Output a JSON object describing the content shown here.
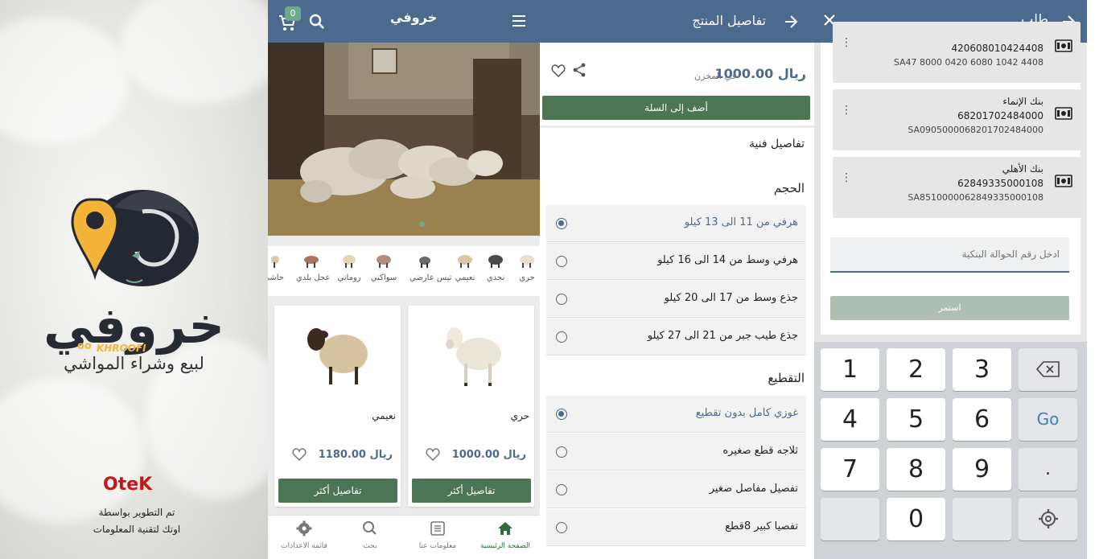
{
  "splash": {
    "brand_ar": "خروفي",
    "brand_latin": "KHROOFI",
    "tagline": "لبيع وشراء المواشي",
    "dev_logo": "OteK",
    "dev_line1": "تم التطوير بواسطة",
    "dev_line2": "اوتك لتقنية المعلومات"
  },
  "home": {
    "cart_count": "0",
    "logo_text": "خروفي",
    "categories": [
      {
        "label": "حري"
      },
      {
        "label": "نجدي"
      },
      {
        "label": "نعيمي"
      },
      {
        "label": "تيس عارضي"
      },
      {
        "label": "سواكني"
      },
      {
        "label": "روماني"
      },
      {
        "label": "عجل بلدي"
      },
      {
        "label": "حاشي"
      }
    ],
    "products": [
      {
        "name": "حري",
        "price": "ريال 1000.00",
        "button": "تفاصيل أكثر"
      },
      {
        "name": "نعيمي",
        "price": "ريال 1180.00",
        "button": "تفاصيل أكثر"
      }
    ],
    "nav": [
      {
        "label": "الصفحة الرئيسية",
        "icon": "home-icon"
      },
      {
        "label": "معلومات عنا",
        "icon": "info-icon"
      },
      {
        "label": "بحث",
        "icon": "search-icon"
      },
      {
        "label": "قائمة الاعدادات",
        "icon": "gear-icon"
      }
    ]
  },
  "product": {
    "title": "تفاصيل المنتج",
    "price": "ريال 1000.00",
    "stock": "في المخزن",
    "add_to_cart": "أضف إلى السلة",
    "tech_details": "تفاصيل فنية",
    "size_title": "الحجم",
    "sizes": [
      {
        "label": "هرفي من 11 الى 13 كيلو",
        "selected": true
      },
      {
        "label": "هرفي وسط من 14 الى 16 كيلو",
        "selected": false
      },
      {
        "label": "جذع وسط من 17 الى 20 كيلو",
        "selected": false
      },
      {
        "label": "جذع طيب جبر من 21 الى 27 كيلو",
        "selected": false
      }
    ],
    "cut_title": "التقطيع",
    "cuts": [
      {
        "label": "غوزي كامل بدون تقطيع",
        "selected": true
      },
      {
        "label": "ثلاجه قطع صغيره",
        "selected": false
      },
      {
        "label": "تفصيل مفاصل صغير",
        "selected": false
      },
      {
        "label": "تفصيا كبير 8قطع",
        "selected": false
      }
    ]
  },
  "order": {
    "title": "طلب",
    "banks": [
      {
        "name": "",
        "account": "420608010424408",
        "iban": "SA47 8000 0420 6080 1042 4408"
      },
      {
        "name": "بنك الإنماء",
        "account": "68201702484000",
        "iban": "SA0905000068201702484000"
      },
      {
        "name": "بنك الأهلي",
        "account": "62849335000108",
        "iban": "SA8510000062849335000108"
      }
    ],
    "transfer_placeholder": "ادخل رقم الحوالة البنكية",
    "continue_label": "استمر",
    "keys": [
      "1",
      "2",
      "3",
      "4",
      "5",
      "6",
      "7",
      "8",
      "9",
      "0",
      "Go",
      "."
    ]
  },
  "colors": {
    "appbar": "#4c6a8d",
    "button_green": "#4b7554",
    "accent_orange": "#f4b43a",
    "badge_green": "#6ea88f"
  }
}
